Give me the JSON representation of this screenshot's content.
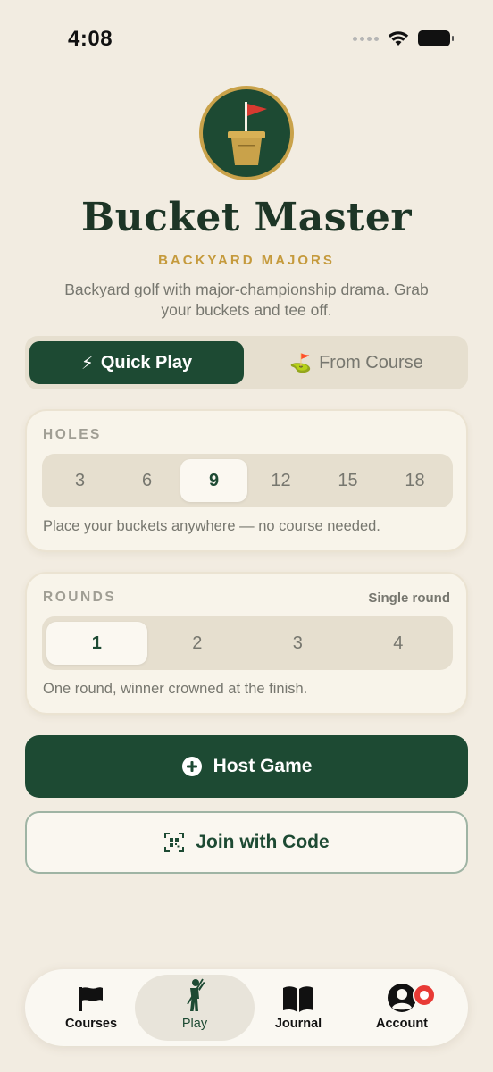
{
  "status_bar": {
    "time": "4:08"
  },
  "header": {
    "title": "Bucket Master",
    "subtitle": "BACKYARD MAJORS",
    "tagline": "Backyard golf with major-championship drama. Grab your buckets and tee off."
  },
  "mode_toggle": {
    "options": [
      {
        "label": "Quick Play",
        "icon": "lightning-icon",
        "selected": true
      },
      {
        "label": "From Course",
        "icon": "golf-flag-emoji-icon",
        "selected": false
      }
    ],
    "quick_emoji": "⚡",
    "course_emoji": "⛳"
  },
  "holes": {
    "label": "HOLES",
    "options": [
      "3",
      "6",
      "9",
      "12",
      "15",
      "18"
    ],
    "selected": "9",
    "hint": "Place your buckets anywhere — no course needed."
  },
  "rounds": {
    "label": "ROUNDS",
    "summary": "Single round",
    "options": [
      "1",
      "2",
      "3",
      "4"
    ],
    "selected": "1",
    "hint": "One round, winner crowned at the finish."
  },
  "actions": {
    "host_label": "Host Game",
    "join_label": "Join with Code"
  },
  "tab_bar": {
    "tabs": [
      {
        "label": "Courses",
        "icon": "flag-icon",
        "active": false
      },
      {
        "label": "Play",
        "icon": "golfer-icon",
        "active": true
      },
      {
        "label": "Journal",
        "icon": "book-icon",
        "active": false
      },
      {
        "label": "Account",
        "icon": "person-icon",
        "active": false,
        "badge": true
      }
    ]
  },
  "colors": {
    "background": "#f2ece1",
    "primary_green": "#1d4a33",
    "gold": "#c59a3c",
    "muted_text": "#77776f",
    "badge_red": "#e83a35"
  }
}
